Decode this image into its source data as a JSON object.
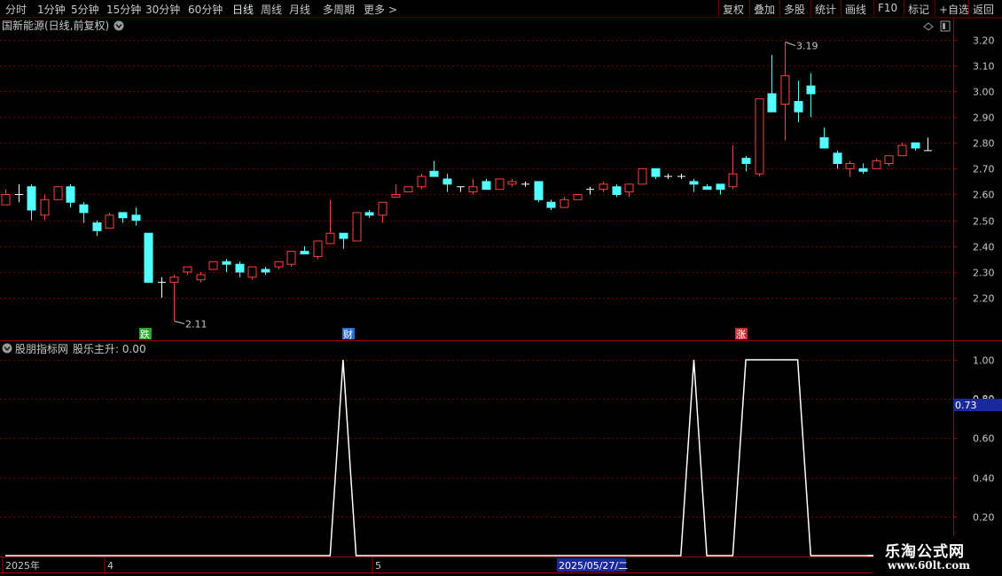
{
  "toolbar": {
    "periods": [
      "分时",
      "1分钟",
      "5分钟",
      "15分钟",
      "30分钟",
      "60分钟",
      "日线",
      "周线",
      "月线",
      "多周期",
      "更多 >"
    ],
    "active_period": "日线",
    "right_buttons": [
      "复权",
      "叠加",
      "多股",
      "统计",
      "画线",
      "F10",
      "标记",
      "+自选",
      "返回"
    ]
  },
  "main_panel": {
    "title": "国新能源(日线,前复权)",
    "high_label": "3.19",
    "low_label": "2.11",
    "events": [
      {
        "label": "跌",
        "color": "#2aa52a"
      },
      {
        "label": "财",
        "color": "#2a6cc8"
      },
      {
        "label": "涨",
        "color": "#c03030"
      }
    ]
  },
  "indicator_panel": {
    "name": "股朋指标网",
    "line_label": "股乐主升:",
    "line_value": "0.00",
    "cursor_value": "0.73"
  },
  "date_axis": {
    "labels": [
      "2025年",
      "4",
      "5"
    ],
    "highlight": "2025/05/27/二"
  },
  "watermark": {
    "line1": "乐淘公式网",
    "line2": "www.60lt.com"
  },
  "colors": {
    "up": "#ff4040",
    "down": "#54ffff",
    "grid": "#7a0000",
    "axis": "#a00000",
    "line": "#ffffff",
    "price_text": "#c8c8c8"
  },
  "chart_data": [
    {
      "type": "candlestick",
      "title": "国新能源(日线,前复权)",
      "y_ticks": [
        "2.20",
        "2.30",
        "2.40",
        "2.50",
        "2.60",
        "2.70",
        "2.80",
        "2.90",
        "3.00",
        "3.10",
        "3.20"
      ],
      "ylim": [
        2.07,
        3.25
      ],
      "ohlc": [
        [
          2.56,
          2.62,
          2.58,
          2.6
        ],
        [
          2.6,
          2.64,
          2.57,
          2.6
        ],
        [
          2.63,
          2.64,
          2.5,
          2.54
        ],
        [
          2.52,
          2.6,
          2.5,
          2.58
        ],
        [
          2.58,
          2.63,
          2.58,
          2.63
        ],
        [
          2.63,
          2.64,
          2.55,
          2.57
        ],
        [
          2.56,
          2.57,
          2.49,
          2.53
        ],
        [
          2.49,
          2.5,
          2.44,
          2.46
        ],
        [
          2.47,
          2.53,
          2.47,
          2.52
        ],
        [
          2.53,
          2.53,
          2.49,
          2.51
        ],
        [
          2.52,
          2.55,
          2.48,
          2.5
        ],
        [
          2.45,
          2.45,
          2.26,
          2.26
        ],
        [
          2.26,
          2.28,
          2.2,
          2.26
        ],
        [
          2.26,
          2.29,
          2.11,
          2.28
        ],
        [
          2.3,
          2.32,
          2.29,
          2.32
        ],
        [
          2.27,
          2.3,
          2.26,
          2.29
        ],
        [
          2.31,
          2.34,
          2.31,
          2.34
        ],
        [
          2.34,
          2.35,
          2.3,
          2.33
        ],
        [
          2.33,
          2.34,
          2.28,
          2.3
        ],
        [
          2.28,
          2.32,
          2.27,
          2.32
        ],
        [
          2.31,
          2.32,
          2.29,
          2.3
        ],
        [
          2.32,
          2.34,
          2.31,
          2.34
        ],
        [
          2.33,
          2.38,
          2.32,
          2.38
        ],
        [
          2.38,
          2.4,
          2.37,
          2.37
        ],
        [
          2.36,
          2.42,
          2.35,
          2.42
        ],
        [
          2.41,
          2.58,
          2.41,
          2.45
        ],
        [
          2.45,
          2.45,
          2.39,
          2.43
        ],
        [
          2.42,
          2.53,
          2.42,
          2.53
        ],
        [
          2.53,
          2.54,
          2.51,
          2.52
        ],
        [
          2.52,
          2.57,
          2.49,
          2.57
        ],
        [
          2.59,
          2.64,
          2.59,
          2.6
        ],
        [
          2.61,
          2.63,
          2.61,
          2.63
        ],
        [
          2.63,
          2.68,
          2.62,
          2.67
        ],
        [
          2.69,
          2.73,
          2.67,
          2.67
        ],
        [
          2.66,
          2.68,
          2.61,
          2.64
        ],
        [
          2.63,
          2.63,
          2.61,
          2.63
        ],
        [
          2.61,
          2.66,
          2.6,
          2.63
        ],
        [
          2.65,
          2.66,
          2.62,
          2.62
        ],
        [
          2.62,
          2.64,
          2.63,
          2.66
        ],
        [
          2.64,
          2.66,
          2.63,
          2.65
        ],
        [
          2.64,
          2.65,
          2.63,
          2.64
        ],
        [
          2.65,
          2.65,
          2.57,
          2.58
        ],
        [
          2.57,
          2.58,
          2.54,
          2.55
        ],
        [
          2.55,
          2.59,
          2.55,
          2.58
        ],
        [
          2.58,
          2.6,
          2.58,
          2.6
        ],
        [
          2.62,
          2.63,
          2.6,
          2.62
        ],
        [
          2.62,
          2.65,
          2.61,
          2.64
        ],
        [
          2.63,
          2.64,
          2.59,
          2.6
        ],
        [
          2.61,
          2.64,
          2.59,
          2.64
        ],
        [
          2.64,
          2.7,
          2.64,
          2.7
        ],
        [
          2.7,
          2.7,
          2.66,
          2.67
        ],
        [
          2.67,
          2.68,
          2.66,
          2.67
        ],
        [
          2.67,
          2.68,
          2.66,
          2.67
        ],
        [
          2.65,
          2.66,
          2.61,
          2.64
        ],
        [
          2.63,
          2.64,
          2.62,
          2.62
        ],
        [
          2.64,
          2.64,
          2.6,
          2.62
        ],
        [
          2.63,
          2.79,
          2.62,
          2.68
        ],
        [
          2.74,
          2.75,
          2.69,
          2.72
        ],
        [
          2.68,
          2.97,
          2.67,
          2.97
        ],
        [
          2.99,
          3.14,
          2.92,
          2.92
        ],
        [
          2.95,
          3.19,
          2.81,
          3.06
        ],
        [
          2.96,
          3.04,
          2.88,
          2.92
        ],
        [
          3.02,
          3.07,
          2.9,
          2.99
        ],
        [
          2.82,
          2.86,
          2.79,
          2.78
        ],
        [
          2.76,
          2.77,
          2.7,
          2.72
        ],
        [
          2.7,
          2.73,
          2.67,
          2.72
        ],
        [
          2.7,
          2.72,
          2.68,
          2.69
        ],
        [
          2.7,
          2.74,
          2.7,
          2.73
        ],
        [
          2.72,
          2.75,
          2.71,
          2.75
        ],
        [
          2.75,
          2.8,
          2.75,
          2.79
        ],
        [
          2.8,
          2.8,
          2.77,
          2.78
        ],
        [
          2.77,
          2.82,
          2.77,
          2.77
        ]
      ]
    },
    {
      "type": "line",
      "title": "股朋指标网",
      "series": [
        {
          "name": "股乐主升",
          "values": [
            0,
            0,
            0,
            0,
            0,
            0,
            0,
            0,
            0,
            0,
            0,
            0,
            0,
            0,
            0,
            0,
            0,
            0,
            0,
            0,
            0,
            0,
            0,
            0,
            0,
            0,
            1,
            0,
            0,
            0,
            0,
            0,
            0,
            0,
            0,
            0,
            0,
            0,
            0,
            0,
            0,
            0,
            0,
            0,
            0,
            0,
            0,
            0,
            0,
            0,
            0,
            0,
            0,
            1,
            0,
            0,
            0,
            1,
            1,
            1,
            1,
            1,
            0,
            0,
            0,
            0,
            0,
            0,
            0,
            0,
            0,
            0,
            0,
            0,
            0,
            0
          ]
        }
      ],
      "y_ticks": [
        "0.20",
        "0.40",
        "0.60",
        "0.80",
        "1.00"
      ],
      "ylim": [
        0.0,
        1.0
      ]
    }
  ]
}
